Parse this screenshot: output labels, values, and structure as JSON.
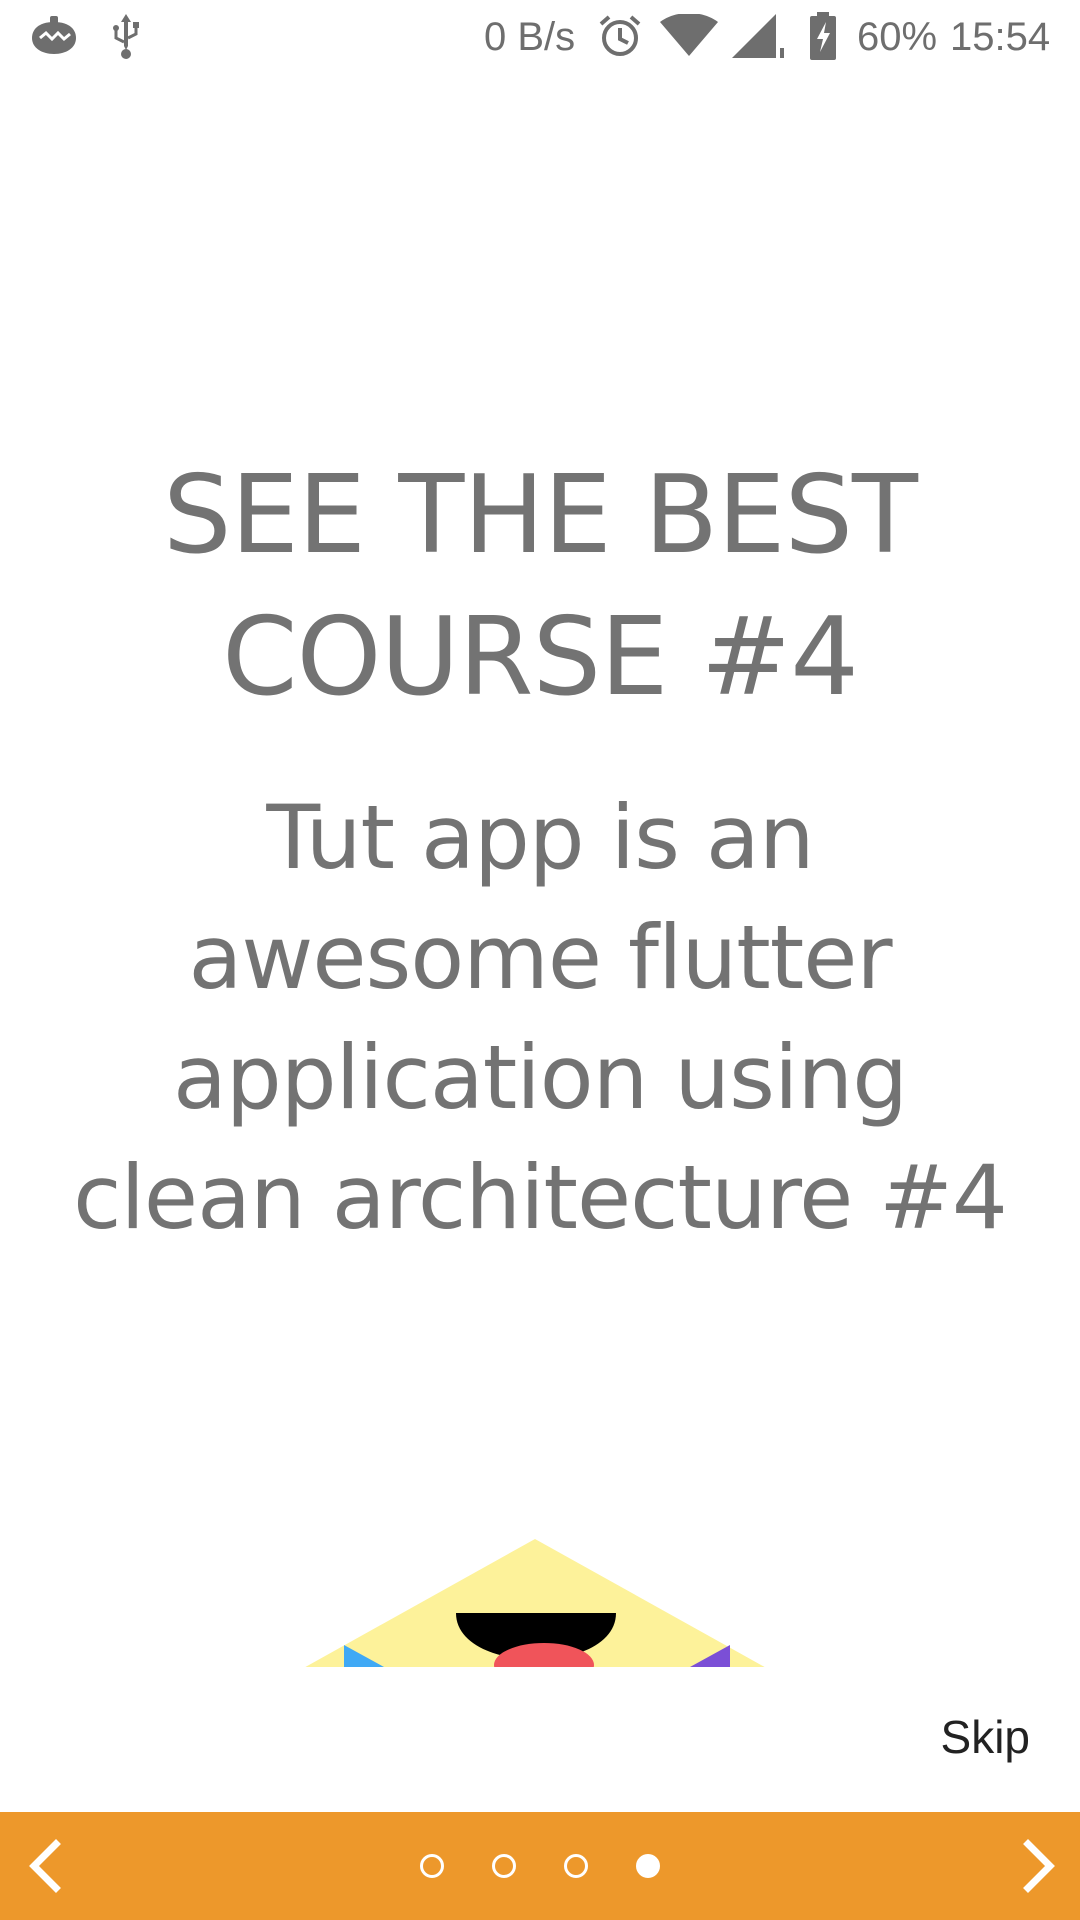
{
  "status_bar": {
    "left_icons": [
      "notification-app-icon",
      "usb-icon"
    ],
    "net_speed": "0 B/s",
    "right_icons": [
      "alarm-icon",
      "wifi-icon",
      "cell-signal-icon",
      "battery-charging-icon"
    ],
    "battery": "60%",
    "time": "15:54"
  },
  "onboarding": {
    "title_lines": [
      "SEE THE BEST",
      "COURSE #4"
    ],
    "subtitle_lines": [
      "Tut app is an",
      "awesome flutter",
      "application using",
      "clean architecture #4"
    ],
    "skip_label": "Skip"
  },
  "pager": {
    "page_count": 4,
    "current_page": 4,
    "prev_icon": "chevron-left-icon",
    "next_icon": "chevron-right-icon"
  },
  "colors": {
    "accent": "#ED982B",
    "text": "#737373",
    "illustration_yellow": "#FDF29A",
    "illustration_blue": "#3FA9F5",
    "illustration_purple": "#7B4FD6",
    "illustration_red": "#F0545A"
  }
}
